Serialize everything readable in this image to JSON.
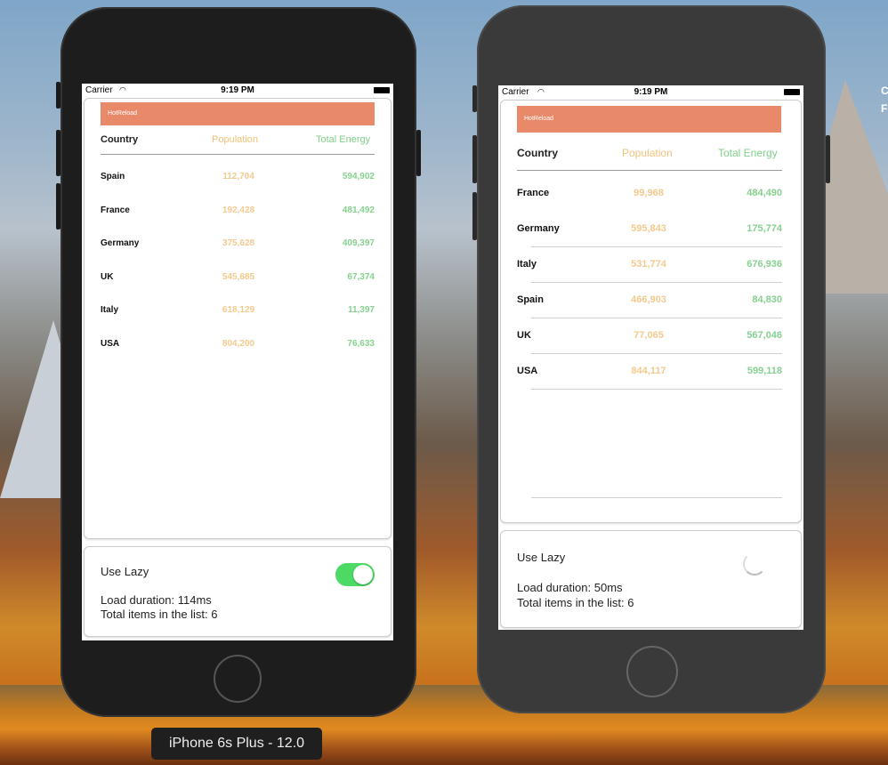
{
  "simulator_label": "iPhone 6s Plus - 12.0",
  "edge_text": [
    "C",
    "F"
  ],
  "left_phone": {
    "status": {
      "carrier": "Carrier",
      "time": "9:19 PM"
    },
    "banner": "HotReload",
    "headers": {
      "country": "Country",
      "population": "Population",
      "energy": "Total Energy"
    },
    "rows": [
      {
        "country": "Spain",
        "population": "112,704",
        "energy": "594,902"
      },
      {
        "country": "France",
        "population": "192,428",
        "energy": "481,492"
      },
      {
        "country": "Germany",
        "population": "375,628",
        "energy": "409,397"
      },
      {
        "country": "UK",
        "population": "545,685",
        "energy": "67,374"
      },
      {
        "country": "Italy",
        "population": "618,129",
        "energy": "11,397"
      },
      {
        "country": "USA",
        "population": "804,200",
        "energy": "76,633"
      }
    ],
    "controls": {
      "use_lazy": "Use Lazy",
      "toggle_on": true,
      "load_duration": "Load duration: 114ms",
      "total_items": "Total items in the list: 6"
    }
  },
  "right_phone": {
    "status": {
      "carrier": "Carrier",
      "time": "9:19 PM"
    },
    "banner": "HotReload",
    "headers": {
      "country": "Country",
      "population": "Population",
      "energy": "Total Energy"
    },
    "rows": [
      {
        "country": "France",
        "population": "99,968",
        "energy": "484,490"
      },
      {
        "country": "Germany",
        "population": "595,843",
        "energy": "175,774"
      },
      {
        "country": "Italy",
        "population": "531,774",
        "energy": "676,936"
      },
      {
        "country": "Spain",
        "population": "466,903",
        "energy": "84,830"
      },
      {
        "country": "UK",
        "population": "77,065",
        "energy": "567,046"
      },
      {
        "country": "USA",
        "population": "844,117",
        "energy": "599,118"
      }
    ],
    "controls": {
      "use_lazy": "Use Lazy",
      "load_duration": "Load duration: 50ms",
      "total_items": "Total items in the list: 6"
    }
  },
  "colors": {
    "banner": "#e8896a",
    "population": "#f4c98e",
    "energy": "#86d18f",
    "toggle": "#4cd964"
  }
}
